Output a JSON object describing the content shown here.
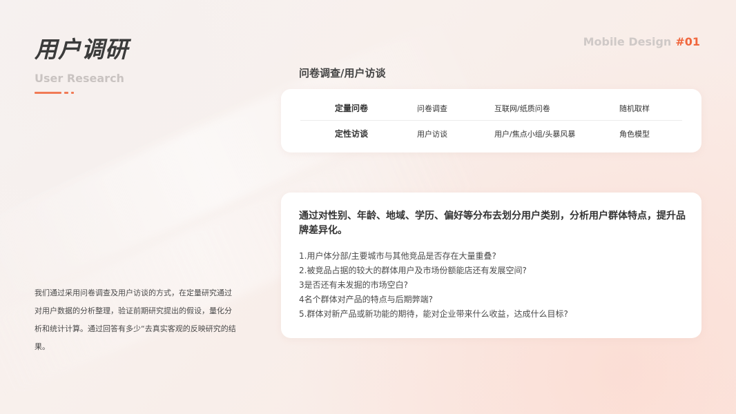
{
  "header": {
    "title": "用户调研",
    "subtitle": "User Research",
    "brand": "Mobile Design",
    "brand_number": "#01"
  },
  "colors": {
    "accent": "#f07a55",
    "brand_number": "#f0663c",
    "title": "#3b3b3b",
    "subtitle": "#c9c3c1"
  },
  "methods": {
    "heading": "问卷调查/用户访谈",
    "rows": [
      {
        "type": "定量问卷",
        "method": "问卷调查",
        "channel": "互联网/纸质问卷",
        "sampling": "随机取样"
      },
      {
        "type": "定性访谈",
        "method": "用户访谈",
        "channel": "用户/焦点小组/头暴风暴",
        "sampling": "角色模型"
      }
    ]
  },
  "goals": {
    "headline": "通过对性别、年龄、地域、学历、偏好等分布去划分用户类别，分析用户群体特点，提升品牌差异化。",
    "items": [
      "1.用户体分部/主要城市与其他竞品是否存在大量重叠?",
      "2.被竞品占据的较大的群体用户及市场份额能店还有发展空间?",
      "3是否还有未发掘的市场空白?",
      "4名个群体对产品的特点与后期弊端?",
      "5.群体对新产品或新功能的期待，能对企业带来什么收益，达成什么目标?"
    ]
  },
  "intro": {
    "text": "我们通过采用问卷调查及用户访谈的方式，在定量研究通过对用户数据的分析整理，验证前期研究提出的假设，量化分析和统计计算。通过回答有多少“去真实客观的反映研究的结果。"
  }
}
